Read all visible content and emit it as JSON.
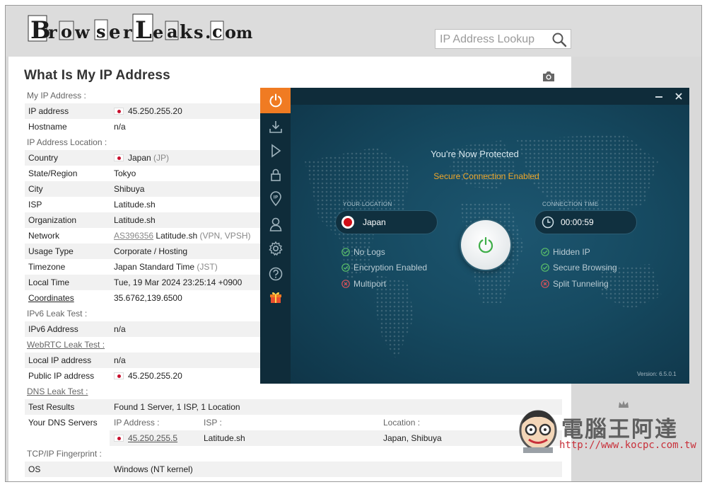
{
  "site": {
    "logo_text": "BrowserLeaks.com",
    "search_placeholder": "IP Address Lookup"
  },
  "page": {
    "title": "What Is My IP Address"
  },
  "sections": {
    "my_ip": "My IP Address :",
    "location": "IP Address Location :",
    "ipv6": "IPv6 Leak Test :",
    "webrtc": "WebRTC Leak Test :",
    "dns": "DNS Leak Test :",
    "tcp": "TCP/IP Fingerprint :"
  },
  "rows": {
    "ip_address": {
      "label": "IP address",
      "value": "45.250.255.20"
    },
    "hostname": {
      "label": "Hostname",
      "value": "n/a"
    },
    "country": {
      "label": "Country",
      "value": "Japan",
      "code": "(JP)"
    },
    "state": {
      "label": "State/Region",
      "value": "Tokyo"
    },
    "city": {
      "label": "City",
      "value": "Shibuya"
    },
    "isp": {
      "label": "ISP",
      "value": "Latitude.sh"
    },
    "org": {
      "label": "Organization",
      "value": "Latitude.sh"
    },
    "network": {
      "label": "Network",
      "asn": "AS396356",
      "value": "Latitude.sh",
      "extra": "(VPN, VPSH)"
    },
    "usage": {
      "label": "Usage Type",
      "value": "Corporate / Hosting"
    },
    "timezone": {
      "label": "Timezone",
      "value": "Japan Standard Time",
      "extra": "(JST)"
    },
    "local_time": {
      "label": "Local Time",
      "value": "Tue, 19 Mar 2024 23:25:14 +0900"
    },
    "coordinates": {
      "label": "Coordinates",
      "value": "35.6762,139.6500"
    },
    "ipv6_address": {
      "label": "IPv6 Address",
      "value": "n/a"
    },
    "local_ip": {
      "label": "Local IP address",
      "value": "n/a"
    },
    "public_ip": {
      "label": "Public IP address",
      "value": "45.250.255.20"
    },
    "test_results": {
      "label": "Test Results",
      "value": "Found 1 Server, 1 ISP, 1 Location"
    },
    "dns_servers": {
      "label": "Your DNS Servers",
      "col_ip": "IP Address :",
      "col_isp": "ISP :",
      "col_location": "Location :",
      "ip": "45.250.255.5",
      "isp": "Latitude.sh",
      "location": "Japan, Shibuya"
    },
    "os": {
      "label": "OS",
      "value": "Windows (NT kernel)"
    }
  },
  "vpn": {
    "heading": "You're Now Protected",
    "subheading": "Secure Connection Enabled",
    "your_location_label": "YOUR LOCATION",
    "location": "Japan",
    "connection_time_label": "CONNECTION TIME",
    "connection_time": "00:00:59",
    "features_left": [
      {
        "label": "No Logs",
        "enabled": true
      },
      {
        "label": "Encryption Enabled",
        "enabled": true
      },
      {
        "label": "Multiport",
        "enabled": false
      }
    ],
    "features_right": [
      {
        "label": "Hidden IP",
        "enabled": true
      },
      {
        "label": "Secure Browsing",
        "enabled": true
      },
      {
        "label": "Split Tunneling",
        "enabled": false
      }
    ],
    "version": "Version: 6.5.0.1",
    "colors": {
      "accent": "#f07b22",
      "enabled": "#5bbf6a",
      "disabled": "#d9525a",
      "warning": "#f0a72a"
    },
    "sidebar_icons": [
      "power-icon",
      "download-icon",
      "play-icon",
      "lock-icon",
      "ip-pin-icon",
      "user-icon",
      "gear-icon",
      "help-icon",
      "gift-icon"
    ]
  },
  "watermark": {
    "title": "電腦王阿達",
    "url": "http://www.kocpc.com.tw"
  }
}
